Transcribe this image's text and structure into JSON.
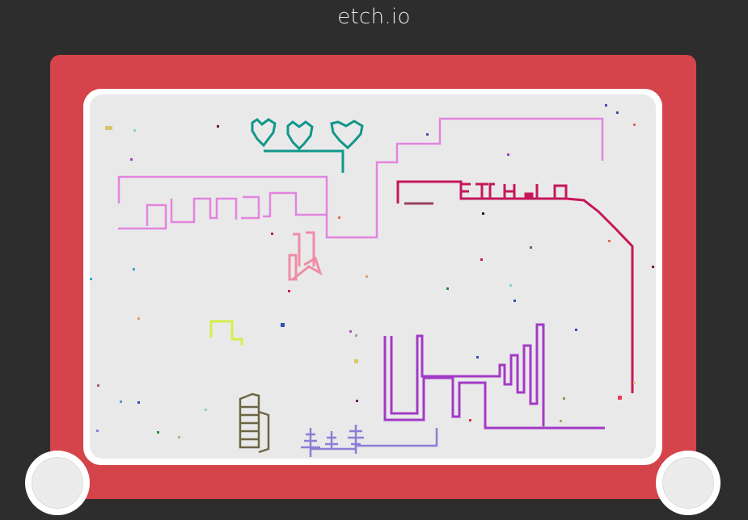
{
  "app": {
    "title": "etch.io"
  },
  "canvas": {
    "background": "#e9e9e9",
    "drawing_text": "ETCH.IO",
    "colors": {
      "frame": "#d5434b",
      "teal": "#12968a",
      "violet_pink": "#e284e0",
      "crimson": "#c4185a",
      "pink": "#f08ca8",
      "lime": "#d4ee4c",
      "olive": "#6b6642",
      "purple": "#a33ac6",
      "lavender": "#8a7fd6"
    }
  },
  "knobs": {
    "left": "horizontal-knob",
    "right": "vertical-knob"
  }
}
